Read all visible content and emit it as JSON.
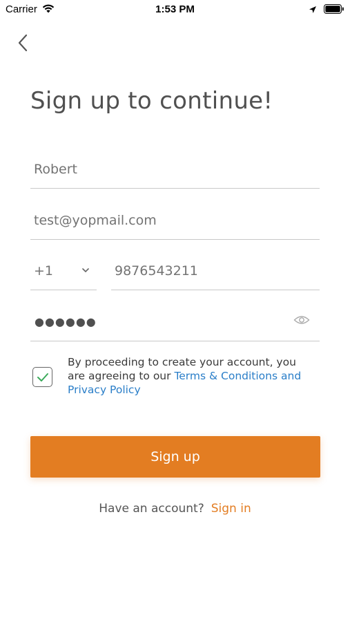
{
  "status_bar": {
    "carrier": "Carrier",
    "time": "1:53 PM"
  },
  "icons": {
    "back": "chevron-left-icon",
    "country_dropdown": "chevron-down-icon",
    "password_visibility": "eye-icon",
    "checkbox": "checkmark-icon"
  },
  "title": "Sign up to continue!",
  "form": {
    "name_value": "Robert",
    "email_value": "test@yopmail.com",
    "country_code": "+1",
    "phone_value": "9876543211",
    "password_masked": "●●●●●●",
    "consent_checked": true,
    "consent_text": "By proceeding to create your account, you are agreeing to our ",
    "consent_link": "Terms & Conditions and Privacy Policy"
  },
  "signup_button_label": "Sign up",
  "signin": {
    "prompt": "Have an account?",
    "link": "Sign in"
  },
  "colors": {
    "accent": "#e37d22",
    "link": "#2a7ec8",
    "checkmark": "#3aaa5a"
  }
}
